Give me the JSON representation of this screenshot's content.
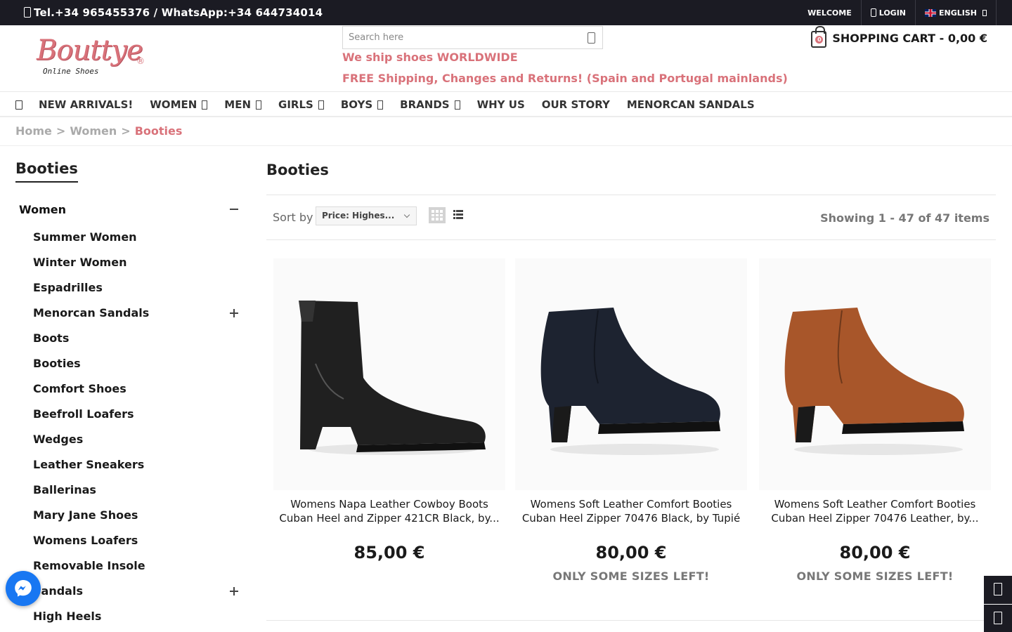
{
  "topbar": {
    "contact": "Tel.+34 965455376 / WhatsApp:+34 644734014",
    "welcome": "WELCOME",
    "login": "LOGIN",
    "language": "ENGLISH"
  },
  "header": {
    "logo_word": "Bouttye",
    "logo_tagline": "Online Shoes",
    "logo_reg": "®",
    "search_placeholder": "Search here",
    "promo_line1": "We ship shoes WORLDWIDE",
    "promo_line2": "FREE Shipping, Changes and Returns! (Spain and Portugal mainlands)",
    "cart_count": "0",
    "cart_label": "SHOPPING CART - 0,00 €"
  },
  "nav": {
    "items": [
      {
        "label": "NEW ARRIVALS!",
        "dropdown": false
      },
      {
        "label": "WOMEN",
        "dropdown": true
      },
      {
        "label": "MEN",
        "dropdown": true
      },
      {
        "label": "GIRLS",
        "dropdown": true
      },
      {
        "label": "BOYS",
        "dropdown": true
      },
      {
        "label": "BRANDS",
        "dropdown": true
      },
      {
        "label": "WHY US",
        "dropdown": false
      },
      {
        "label": "OUR STORY",
        "dropdown": false
      },
      {
        "label": "MENORCAN SANDALS",
        "dropdown": false
      }
    ]
  },
  "breadcrumb": {
    "home": "Home",
    "women": "Women",
    "current": "Booties",
    "separator": ">"
  },
  "sidebar": {
    "title": "Booties",
    "parent": "Women",
    "items": [
      {
        "label": "Summer Women",
        "expandable": false
      },
      {
        "label": "Winter Women",
        "expandable": false
      },
      {
        "label": "Espadrilles",
        "expandable": false
      },
      {
        "label": "Menorcan Sandals",
        "expandable": true
      },
      {
        "label": "Boots",
        "expandable": false
      },
      {
        "label": "Booties",
        "expandable": false
      },
      {
        "label": "Comfort Shoes",
        "expandable": false
      },
      {
        "label": "Beefroll Loafers",
        "expandable": false
      },
      {
        "label": "Wedges",
        "expandable": false
      },
      {
        "label": "Leather Sneakers",
        "expandable": false
      },
      {
        "label": "Ballerinas",
        "expandable": false
      },
      {
        "label": "Mary Jane Shoes",
        "expandable": false
      },
      {
        "label": "Womens Loafers",
        "expandable": false
      },
      {
        "label": "Removable Insole",
        "expandable": false
      },
      {
        "label": "Sandals",
        "expandable": true
      },
      {
        "label": "High Heels",
        "expandable": false
      }
    ]
  },
  "main": {
    "title": "Booties",
    "sort_label": "Sort by",
    "sort_value": "Price: Highes...",
    "showing": "Showing 1 - 47 of 47 items"
  },
  "products": [
    {
      "name": "Womens Napa Leather Cowboy Boots Cuban Heel and Zipper 421CR Black, by...",
      "price": "85,00 €",
      "stock": "",
      "color": "#202020"
    },
    {
      "name": "Womens Soft Leather Comfort Booties Cuban Heel Zipper 70476 Black, by Tupié",
      "price": "80,00 €",
      "stock": "ONLY SOME SIZES LEFT!",
      "color": "#1d2330"
    },
    {
      "name": "Womens Soft Leather Comfort Booties Cuban Heel Zipper 70476 Leather, by...",
      "price": "80,00 €",
      "stock": "ONLY SOME SIZES LEFT!",
      "color": "#a8562a"
    }
  ],
  "colors": {
    "accent": "#d9727a",
    "topbar": "#1b1b23",
    "messenger": "#1877f2"
  }
}
